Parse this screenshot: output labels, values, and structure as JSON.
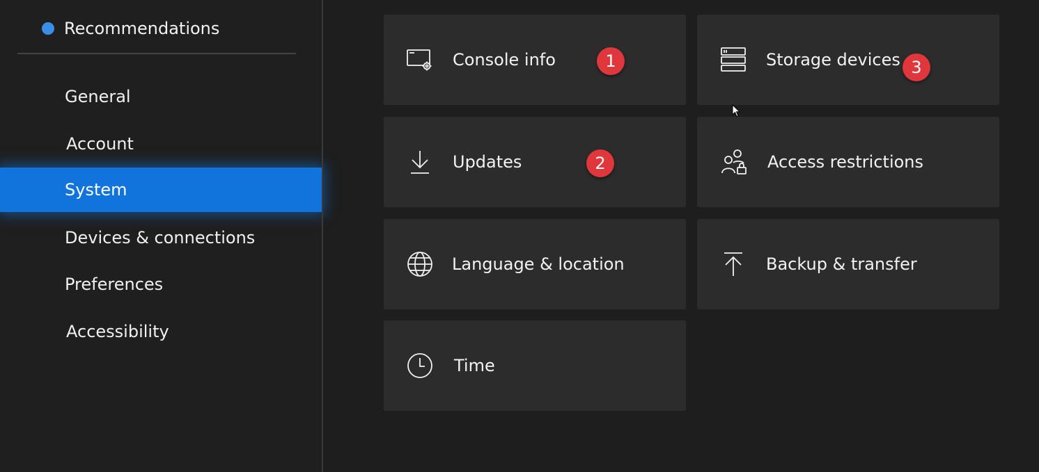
{
  "sidebar": {
    "recommendations": {
      "label": "Recommendations",
      "dot_color": "#3a8ee6"
    },
    "items": [
      {
        "label": "General"
      },
      {
        "label": "Account"
      },
      {
        "label": "System",
        "active": true
      },
      {
        "label": "Devices & connections"
      },
      {
        "label": "Preferences"
      },
      {
        "label": "Accessibility"
      }
    ],
    "active_color": "#1174dc"
  },
  "tiles": [
    {
      "label": "Console info",
      "icon": "console-info-icon",
      "badge": "1"
    },
    {
      "label": "Storage devices",
      "icon": "storage-devices-icon",
      "badge": "3"
    },
    {
      "label": "Updates",
      "icon": "download-icon",
      "badge": "2"
    },
    {
      "label": "Access restrictions",
      "icon": "access-restrictions-icon"
    },
    {
      "label": "Language & location",
      "icon": "globe-icon"
    },
    {
      "label": "Backup & transfer",
      "icon": "upload-icon"
    },
    {
      "label": "Time",
      "icon": "clock-icon"
    }
  ],
  "badge_color": "#e0373c"
}
